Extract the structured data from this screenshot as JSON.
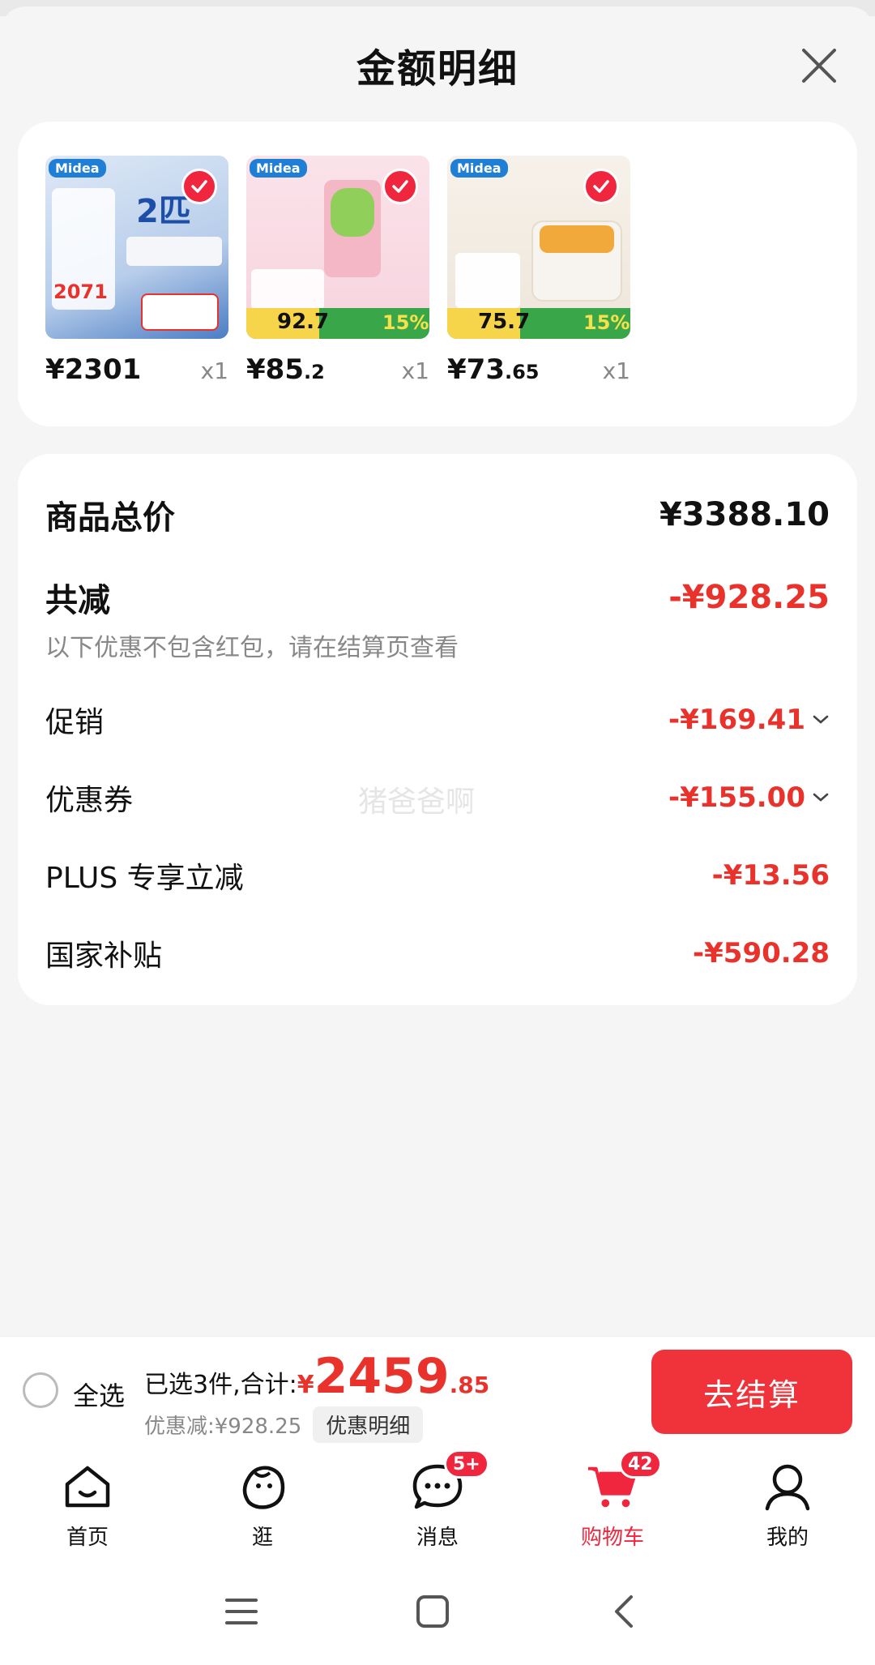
{
  "header": {
    "title": "金额明细"
  },
  "products": [
    {
      "price_int": "¥2301",
      "price_frac": "",
      "qty": "x1",
      "img_big": "2匹",
      "img_price": "2071"
    },
    {
      "price_int": "¥85",
      "price_frac": ".2",
      "qty": "x1",
      "img_big": "92.7",
      "img_price": "15%"
    },
    {
      "price_int": "¥73",
      "price_frac": ".65",
      "qty": "x1",
      "img_big": "75.7",
      "img_price": "15%"
    }
  ],
  "summary": {
    "total_label": "商品总价",
    "total_value": "¥3388.10",
    "discount_label": "共减",
    "discount_value": "-¥928.25",
    "discount_note": "以下优惠不包含红包，请在结算页查看",
    "items": [
      {
        "label": "促销",
        "value": "-¥169.41",
        "expandable": true
      },
      {
        "label": "优惠券",
        "value": "-¥155.00",
        "expandable": true
      },
      {
        "label": "PLUS 专享立减",
        "value": "-¥13.56",
        "expandable": false
      },
      {
        "label": "国家补贴",
        "value": "-¥590.28",
        "expandable": false
      }
    ],
    "watermark": "猪爸爸啊"
  },
  "checkout": {
    "select_all": "全选",
    "selected_text": "已选3件,合计:",
    "yen": "¥",
    "total_int": "2459",
    "total_frac": ".85",
    "discount_text": "优惠减:¥928.25",
    "detail_button": "优惠明细",
    "checkout_button": "去结算"
  },
  "tabs": [
    {
      "label": "首页",
      "icon": "home-icon",
      "badge": ""
    },
    {
      "label": "逛",
      "icon": "browse-icon",
      "badge": ""
    },
    {
      "label": "消息",
      "icon": "message-icon",
      "badge": "5+"
    },
    {
      "label": "购物车",
      "icon": "cart-icon",
      "badge": "42"
    },
    {
      "label": "我的",
      "icon": "profile-icon",
      "badge": ""
    }
  ],
  "colors": {
    "accent": "#f0263f",
    "discount": "#e8322b",
    "checkout_button": "#f0333a"
  }
}
